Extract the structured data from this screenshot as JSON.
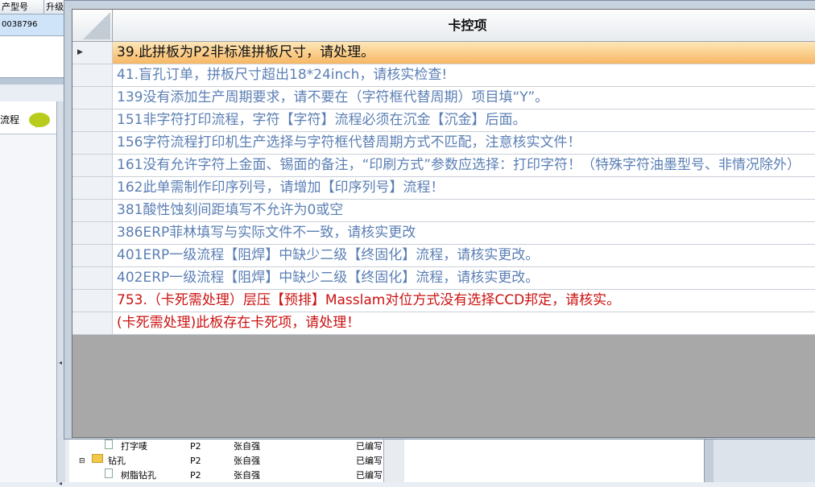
{
  "background_grid": {
    "headers": [
      "产型号",
      "升级"
    ],
    "row_value": "0038796"
  },
  "side_panel": {
    "label": "流程"
  },
  "tree": {
    "rows": [
      {
        "name": "打字唛",
        "code": "P2",
        "person": "张自强",
        "status": "已编写"
      },
      {
        "name": "钻孔",
        "code": "P2",
        "person": "张自强",
        "status": "已编写"
      },
      {
        "name": "树脂钻孔",
        "code": "P2",
        "person": "张自强",
        "status": "已编写"
      }
    ]
  },
  "dialog": {
    "column_header": "卡控项",
    "rows": [
      {
        "text": "39.此拼板为P2非标准拼板尺寸，请处理。",
        "style": "selected"
      },
      {
        "text": "41.盲孔订单，拼板尺寸超出18*24inch，请核实检查!",
        "style": "blue"
      },
      {
        "text": "139没有添加生产周期要求，请不要在（字符框代替周期）项目填“Y”。",
        "style": "blue"
      },
      {
        "text": "151非字符打印流程，字符【字符】流程必须在沉金【沉金】后面。",
        "style": "blue"
      },
      {
        "text": "156字符流程打印机生产选择与字符框代替周期方式不匹配，注意核实文件！",
        "style": "blue"
      },
      {
        "text": "161没有允许字符上金面、锡面的备注，“印刷方式”参数应选择：打印字符！（特殊字符油墨型号、非情况除外）",
        "style": "blue-wrap"
      },
      {
        "text": "162此单需制作印序列号，请增加【印序列号】流程！",
        "style": "blue"
      },
      {
        "text": "381酸性蚀刻间距填写不允许为0或空",
        "style": "blue"
      },
      {
        "text": "386ERP菲林填写与实际文件不一致，请核实更改",
        "style": "blue"
      },
      {
        "text": "401ERP一级流程【阻焊】中缺少二级【终固化】流程，请核实更改。",
        "style": "blue"
      },
      {
        "text": "402ERP一级流程【阻焊】中缺少二级【终固化】流程，请核实更改。",
        "style": "blue"
      },
      {
        "text": "753.（卡死需处理）层压【预排】Masslam对位方式没有选择CCD邦定，请核实。",
        "style": "red"
      },
      {
        "text": "(卡死需处理)此板存在卡死项，请处理！",
        "style": "red"
      }
    ]
  }
}
